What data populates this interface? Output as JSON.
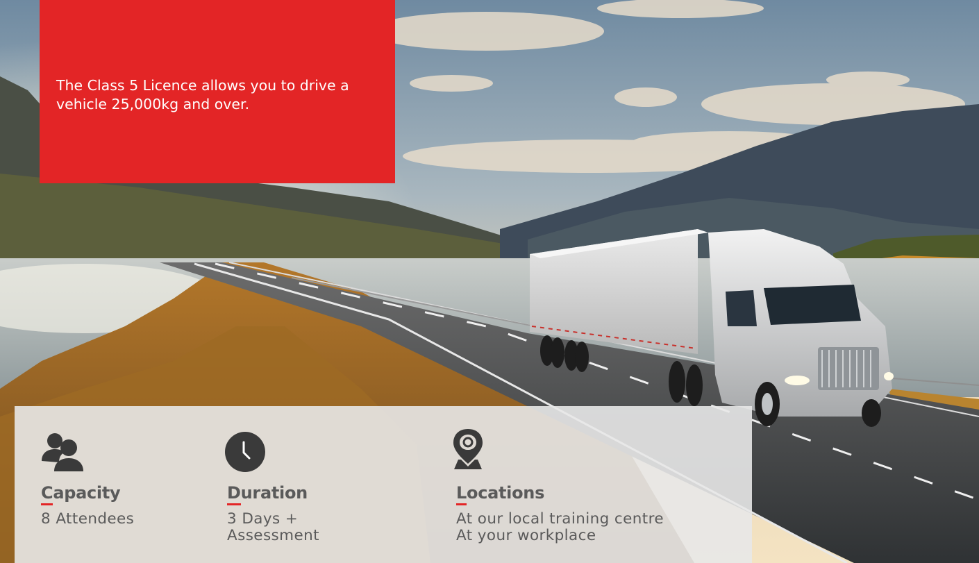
{
  "hero": {
    "tagline": "The Class 5 Licence allows you to drive a vehicle 25,000kg and over.",
    "image_icon": "truck-on-lake-highway-image"
  },
  "info": {
    "capacity": {
      "icon": "people-icon",
      "label_first": "C",
      "label_rest": "apacity",
      "value": "8 Attendees"
    },
    "duration": {
      "icon": "clock-icon",
      "label_first": "D",
      "label_rest": "uration",
      "value_line1": "3 Days +",
      "value_line2": "Assessment"
    },
    "locations": {
      "icon": "map-pin-icon",
      "label_first": "L",
      "label_rest": "ocations",
      "value_line1": "At our local training centre",
      "value_line2": "At your workplace"
    }
  },
  "colors": {
    "accent_red": "#e32526",
    "panel_grey": "#e8e8e8",
    "text_grey": "#5a5a5a",
    "icon_dark": "#3a3a3a"
  }
}
